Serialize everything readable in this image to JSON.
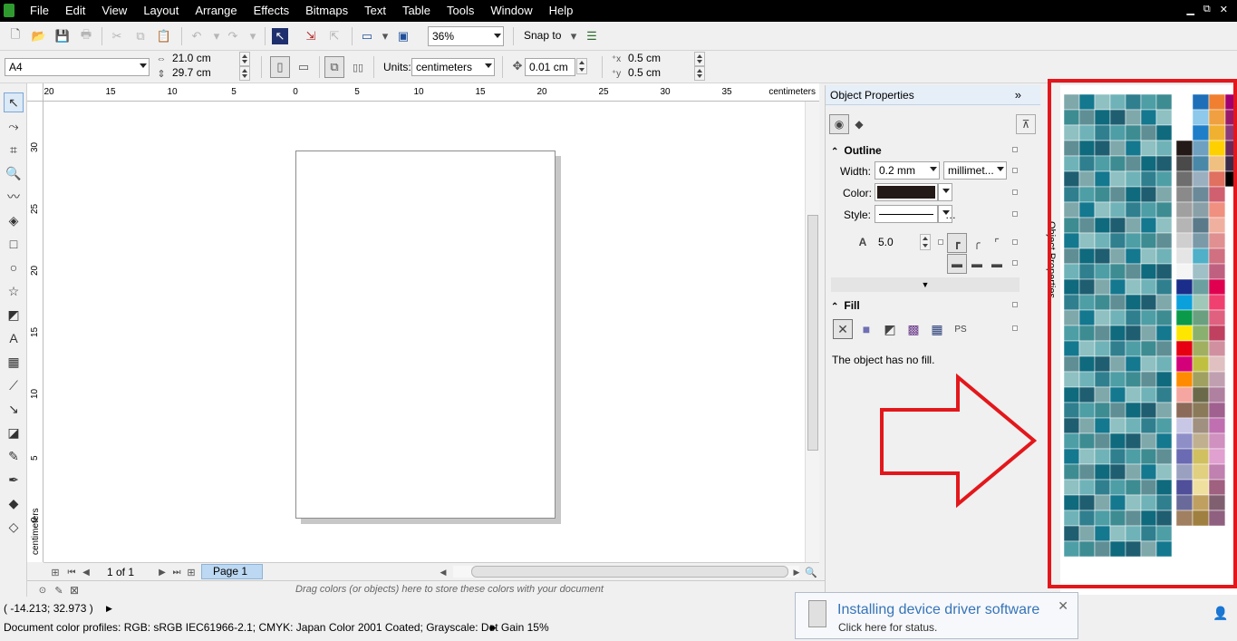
{
  "menubar": {
    "items": [
      "File",
      "Edit",
      "View",
      "Layout",
      "Arrange",
      "Effects",
      "Bitmaps",
      "Text",
      "Table",
      "Tools",
      "Window",
      "Help"
    ],
    "window_controls": [
      "▁",
      "⧉",
      "✕"
    ]
  },
  "toolbar_standard": {
    "zoom": "36%",
    "snap_label": "Snap to"
  },
  "property_bar": {
    "page_size": "A4",
    "width": "21.0 cm",
    "height": "29.7 cm",
    "units_label": "Units:",
    "units": "centimeters",
    "nudge": "0.01 cm",
    "dup_x": "0.5 cm",
    "dup_y": "0.5 cm"
  },
  "rulers": {
    "h_ticks": [
      "20",
      "15",
      "10",
      "5",
      "0",
      "5",
      "10",
      "15",
      "20",
      "25",
      "30",
      "35"
    ],
    "v_ticks": [
      "30",
      "25",
      "20",
      "15",
      "10",
      "5",
      "0"
    ],
    "unit": "centimeters"
  },
  "page_nav": {
    "counter": "1 of 1",
    "tab": "Page 1"
  },
  "doc_palette": {
    "hint": "Drag colors (or objects) here to store these colors with your document"
  },
  "status": {
    "cursor": "( -14.213; 32.973 )",
    "profiles": "Document color profiles: RGB: sRGB IEC61966-2.1; CMYK: Japan Color 2001 Coated; Grayscale: Dot Gain 15%"
  },
  "docker": {
    "title": "Object Properties",
    "outline": {
      "header": "Outline",
      "width_label": "Width:",
      "width_value": "0.2 mm",
      "width_units": "millimet...",
      "color_label": "Color:",
      "style_label": "Style:",
      "miter_value": "5.0"
    },
    "fill": {
      "header": "Fill",
      "message": "The object has no fill."
    },
    "side_tab": "Object Properties"
  },
  "notification": {
    "title": "Installing device driver software",
    "subtitle": "Click here for status."
  },
  "colors": {
    "accent_red": "#e3171b",
    "outline_color": "#231916"
  }
}
